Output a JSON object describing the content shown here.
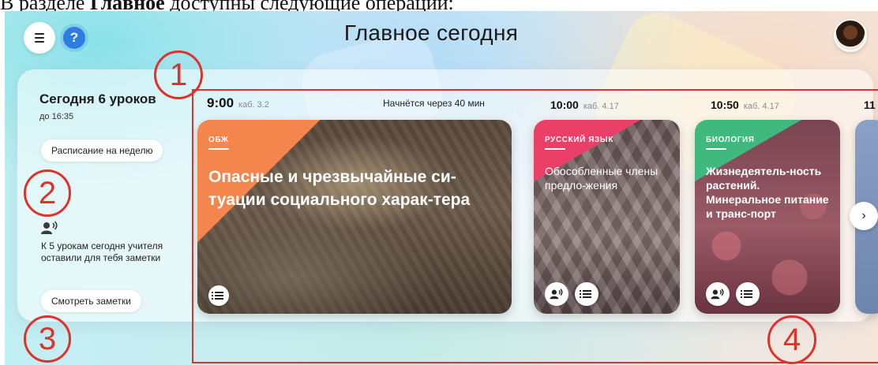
{
  "doc_caption": {
    "prefix": "В разделе ",
    "bold": "Главное",
    "suffix": " доступны следующие операции:"
  },
  "header": {
    "title": "Главное сегодня",
    "help_glyph": "?"
  },
  "summary": {
    "lessons_title": "Сегодня 6 уроков",
    "until": "до 16:35",
    "schedule_button": "Расписание на неделю",
    "notes_text": "К 5 урокам сегодня учителя оставили для тебя заметки",
    "notes_button": "Смотреть заметки"
  },
  "timeline": {
    "starts_in": "Начнётся через 40 мин",
    "slots": [
      {
        "time": "9:00",
        "room": "каб. 3.2"
      },
      {
        "time": "10:00",
        "room": "каб. 4.17"
      },
      {
        "time": "10:50",
        "room": "каб. 4.17"
      },
      {
        "time": "11",
        "room": ""
      }
    ]
  },
  "lessons": [
    {
      "subject": "ОБЖ",
      "topic": "Опасные и чрезвычайные си-туации социального харак-тера",
      "color": "#f4864d",
      "has_notes": false
    },
    {
      "subject": "РУССКИЙ ЯЗЫК",
      "topic": "Обособленные члены предло-жения",
      "color": "#ea3f67",
      "has_notes": true
    },
    {
      "subject": "БИОЛОГИЯ",
      "topic": "Жизнедеятель-ность растений. Минеральное питание и транс-порт",
      "color": "#3fb97e",
      "has_notes": true
    }
  ],
  "annotations": [
    "1",
    "2",
    "3",
    "4"
  ],
  "next_glyph": "›",
  "icons": [
    "menu-icon",
    "help-icon",
    "avatar",
    "teacher-voice-icon",
    "list-icon",
    "chevron-right-icon"
  ],
  "colors": {
    "annotation": "#e0322c",
    "help": "#2f7de1"
  }
}
